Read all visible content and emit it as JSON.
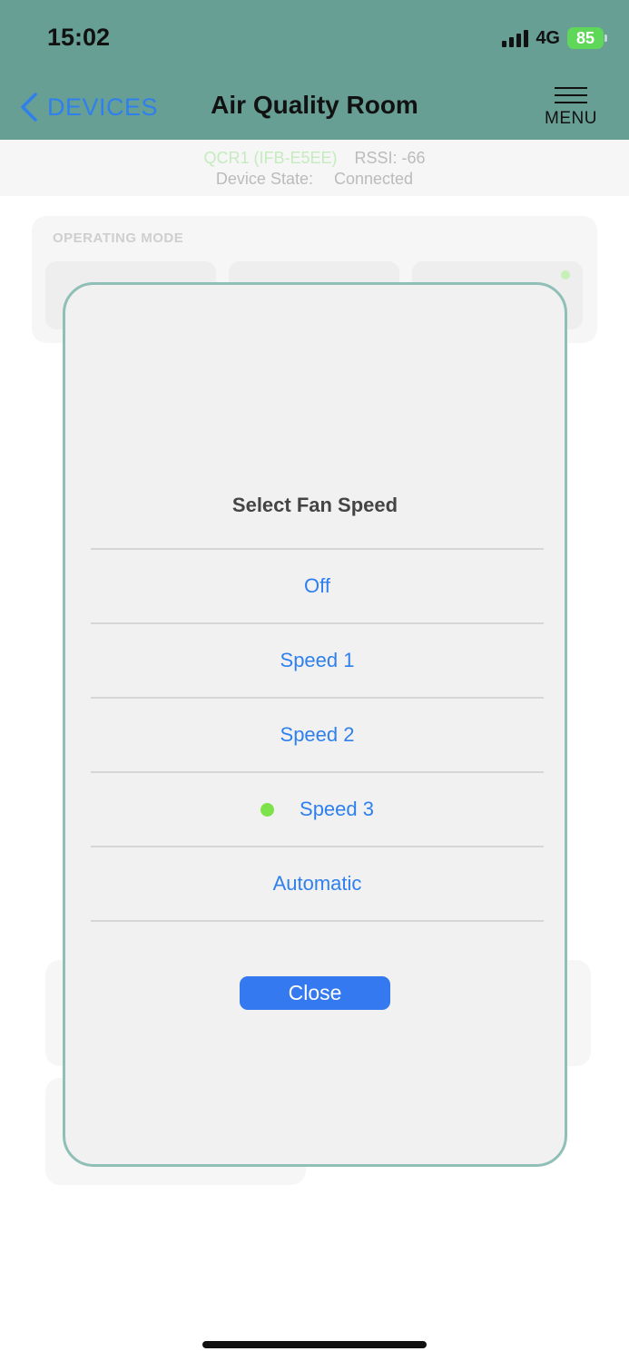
{
  "status_bar": {
    "time": "15:02",
    "network": "4G",
    "battery": "85"
  },
  "header": {
    "back_label": "DEVICES",
    "title": "Air Quality Room",
    "menu_label": "MENU",
    "background_color": "#679f95",
    "accent_color": "#2f80ed"
  },
  "device_info": {
    "name": "QCR1 (IFB-E5EE)",
    "rssi_label": "RSSI: -66",
    "state_label": "Device State:",
    "state_value": "Connected"
  },
  "operating_mode": {
    "label": "OPERATING MODE"
  },
  "modal": {
    "title": "Select Fan Speed",
    "options": [
      {
        "label": "Off",
        "selected": false
      },
      {
        "label": "Speed 1",
        "selected": false
      },
      {
        "label": "Speed 2",
        "selected": false
      },
      {
        "label": "Speed 3",
        "selected": true
      },
      {
        "label": "Automatic",
        "selected": false
      }
    ],
    "close_label": "Close",
    "selected_indicator_color": "#7ee34a"
  }
}
